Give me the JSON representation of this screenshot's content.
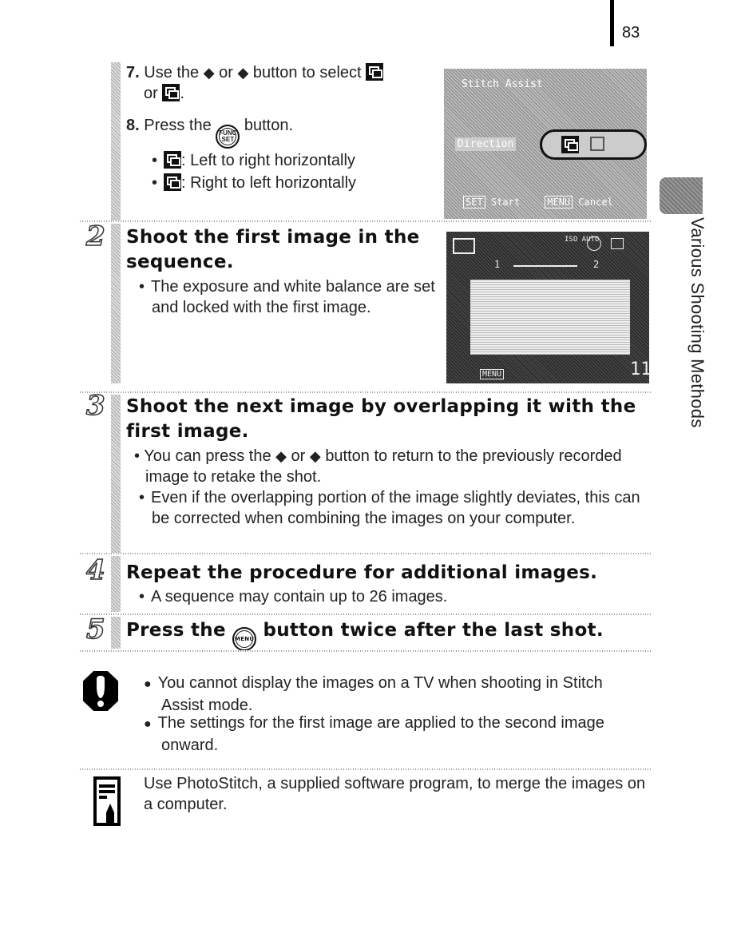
{
  "page": {
    "number": "83",
    "section_tab_label": "Various Shooting Methods"
  },
  "substeps": {
    "step7": {
      "num": "7.",
      "text_before": "Use the",
      "or1": "or",
      "text_after": "button to select",
      "line2_or": "or",
      "line2_end": "."
    },
    "step8": {
      "num": "8.",
      "text_before": "Press the",
      "button_label": "FUNC SET",
      "text_after": "button."
    },
    "options": [
      {
        "icon": "left-to-right-icon",
        "text": ": Left to right horizontally"
      },
      {
        "icon": "right-to-left-icon",
        "text": ": Right to left horizontally"
      }
    ]
  },
  "lcd1": {
    "title": "Stitch Assist",
    "direction_label": "Direction",
    "set_label": "SET",
    "start_label": "Start",
    "menu_label": "MENU",
    "cancel_label": "Cancel"
  },
  "lcd2": {
    "frame_left": "1",
    "frame_right": "2",
    "shots_remaining": "11",
    "menu_label": "MENU",
    "iso": "ISO AUTO"
  },
  "steps": [
    {
      "number": "2",
      "heading": "Shoot the first image in the sequence.",
      "bullets": [
        "The exposure and white balance are set and locked with the first image."
      ]
    },
    {
      "number": "3",
      "heading": "Shoot the next image by overlapping it with the first image.",
      "bullets": [
        "You can press the ◆ or ◆ button to return to the previously recorded image to retake the shot.",
        "Even if the overlapping portion of the image slightly deviates, this can be corrected when combining the images on your computer."
      ],
      "bullet1_a": "You can press the",
      "bullet1_or": "or",
      "bullet1_b": "button to return to the previously recorded image to retake the shot."
    },
    {
      "number": "4",
      "heading": "Repeat the procedure for additional images.",
      "bullets": [
        "A sequence may contain up to 26 images."
      ]
    },
    {
      "number": "5",
      "heading_before": "Press the",
      "button_label": "MENU",
      "heading_after": "button twice after the last shot."
    }
  ],
  "caution": {
    "items": [
      "You cannot display the images on a TV when shooting in Stitch Assist mode.",
      "The settings for the first image are applied to the second image onward."
    ]
  },
  "memo": {
    "text": "Use PhotoStitch, a supplied software program, to merge the images on a computer."
  }
}
